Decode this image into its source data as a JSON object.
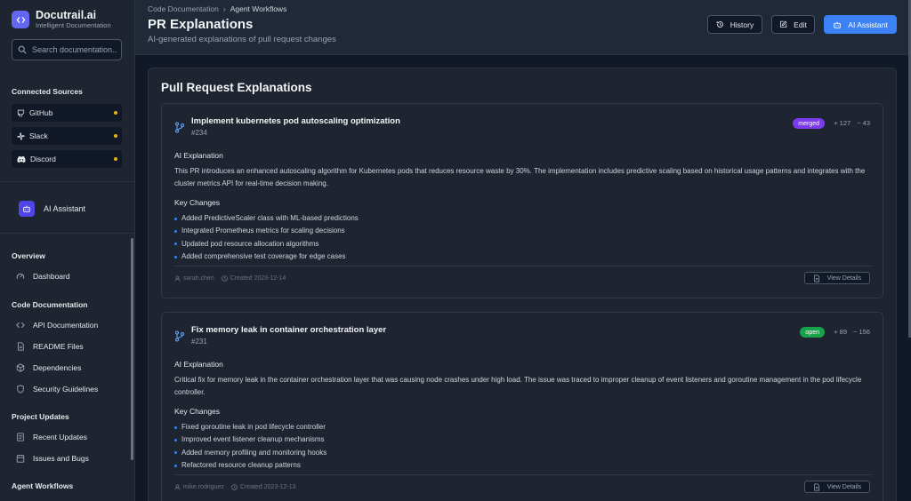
{
  "brand": {
    "name": "Docutrail.ai",
    "subtitle": "Intelligent Documentation"
  },
  "search": {
    "placeholder": "Search documentation..."
  },
  "connected_sources": {
    "title": "Connected Sources",
    "items": [
      {
        "label": "GitHub",
        "icon": "github-icon",
        "status_color": "#eab308"
      },
      {
        "label": "Slack",
        "icon": "slack-icon",
        "status_color": "#eab308"
      },
      {
        "label": "Discord",
        "icon": "discord-icon",
        "status_color": "#eab308"
      }
    ]
  },
  "sidebar_ai": {
    "label": "AI Assistant"
  },
  "nav": {
    "overview": {
      "title": "Overview",
      "items": [
        {
          "label": "Dashboard"
        }
      ]
    },
    "code_docs": {
      "title": "Code Documentation",
      "items": [
        {
          "label": "API Documentation"
        },
        {
          "label": "README Files"
        },
        {
          "label": "Dependencies"
        },
        {
          "label": "Security Guidelines"
        }
      ]
    },
    "project_updates": {
      "title": "Project Updates",
      "items": [
        {
          "label": "Recent Updates"
        },
        {
          "label": "Issues and Bugs"
        }
      ]
    },
    "agent_workflows": {
      "title": "Agent Workflows"
    }
  },
  "header": {
    "breadcrumb": [
      "Code Documentation",
      "Agent Workflows"
    ],
    "breadcrumb_sep": "›",
    "title": "PR Explanations",
    "subtitle": "AI-generated explanations of pull request changes",
    "history_label": "History",
    "edit_label": "Edit",
    "ai_label": "AI Assistant"
  },
  "panel": {
    "title": "Pull Request Explanations",
    "expl_label": "AI Explanation",
    "kc_label": "Key Changes",
    "view_label": "View Details"
  },
  "prs": [
    {
      "title": "Implement kubernetes pod autoscaling optimization",
      "number": "#234",
      "status": "merged",
      "additions": "+ 127",
      "deletions": "− 43",
      "explanation": "This PR introduces an enhanced autoscaling algorithm for Kubernetes pods that reduces resource waste by 30%. The implementation includes predictive scaling based on historical usage patterns and integrates with the cluster metrics API for real-time decision making.",
      "changes": [
        "Added PredictiveScaler class with ML-based predictions",
        "Integrated Prometheus metrics for scaling decisions",
        "Updated pod resource allocation algorithms",
        "Added comprehensive test coverage for edge cases"
      ],
      "author": "sarah.chen",
      "created": "Created 2023-12-14"
    },
    {
      "title": "Fix memory leak in container orchestration layer",
      "number": "#231",
      "status": "open",
      "additions": "+ 89",
      "deletions": "− 156",
      "explanation": "Critical fix for memory leak in the container orchestration layer that was causing node crashes under high load. The issue was traced to improper cleanup of event listeners and goroutine management in the pod lifecycle controller.",
      "changes": [
        "Fixed goroutine leak in pod lifecycle controller",
        "Improved event listener cleanup mechanisms",
        "Added memory profiling and monitoring hooks",
        "Refactored resource cleanup patterns"
      ],
      "author": "mike.rodriguez",
      "created": "Created 2023-12-13"
    }
  ],
  "colors": {
    "accent": "#3b82f6",
    "brand": "#6366f1",
    "merged": "#7c3aed",
    "open": "#16a34a",
    "status_dot": "#eab308"
  }
}
